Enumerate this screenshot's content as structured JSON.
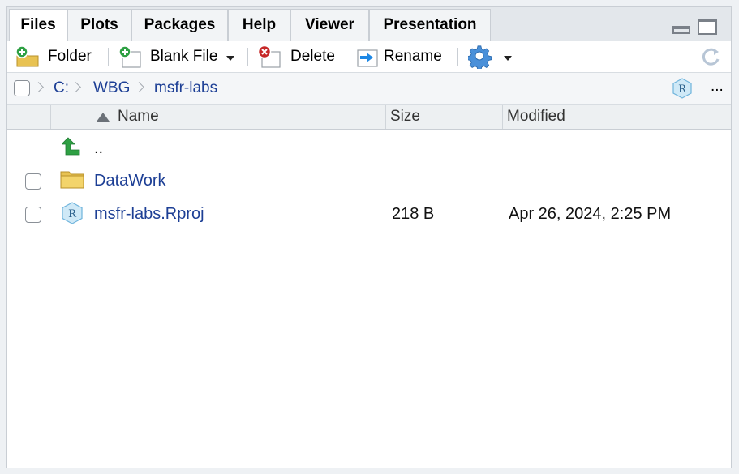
{
  "tabs": [
    {
      "label": "Files",
      "active": true
    },
    {
      "label": "Plots"
    },
    {
      "label": "Packages"
    },
    {
      "label": "Help"
    },
    {
      "label": "Viewer"
    },
    {
      "label": "Presentation"
    }
  ],
  "toolbar": {
    "folder_label": "Folder",
    "blank_file_label": "Blank File",
    "delete_label": "Delete",
    "rename_label": "Rename",
    "icons": {
      "new_folder": "new-folder-icon",
      "new_blank_file": "new-blank-file-icon",
      "delete": "delete-icon",
      "rename": "rename-icon",
      "more": "gear-icon",
      "refresh": "refresh-icon"
    }
  },
  "breadcrumb": {
    "segments": [
      "C:",
      "WBG",
      "msfr-labs"
    ],
    "more_label": "..."
  },
  "columns": {
    "name": "Name",
    "size": "Size",
    "modified": "Modified"
  },
  "files": [
    {
      "name": "..",
      "kind": "parent",
      "size": "",
      "modified": ""
    },
    {
      "name": "DataWork",
      "kind": "folder",
      "size": "",
      "modified": ""
    },
    {
      "name": "msfr-labs.Rproj",
      "kind": "rproj",
      "size": "218 B",
      "modified": "Apr 26, 2024, 2:25 PM"
    }
  ],
  "colors": {
    "link": "#1d3f95",
    "accent_green": "#2ea043",
    "folder": "#e8c252",
    "delete_red": "#c62828"
  }
}
